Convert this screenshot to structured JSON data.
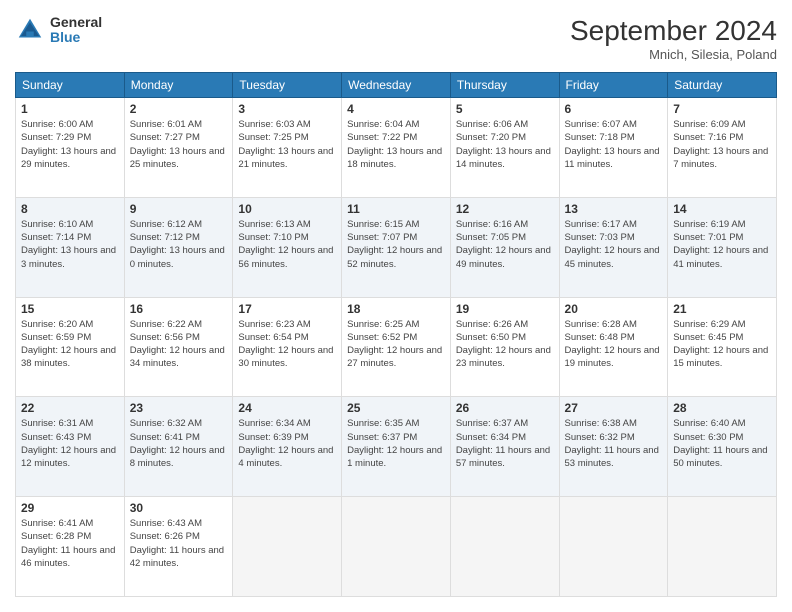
{
  "header": {
    "logo_general": "General",
    "logo_blue": "Blue",
    "month_title": "September 2024",
    "subtitle": "Mnich, Silesia, Poland"
  },
  "days_of_week": [
    "Sunday",
    "Monday",
    "Tuesday",
    "Wednesday",
    "Thursday",
    "Friday",
    "Saturday"
  ],
  "weeks": [
    {
      "days": [
        {
          "num": "1",
          "sunrise": "6:00 AM",
          "sunset": "7:29 PM",
          "daylight": "13 hours and 29 minutes."
        },
        {
          "num": "2",
          "sunrise": "6:01 AM",
          "sunset": "7:27 PM",
          "daylight": "13 hours and 25 minutes."
        },
        {
          "num": "3",
          "sunrise": "6:03 AM",
          "sunset": "7:25 PM",
          "daylight": "13 hours and 21 minutes."
        },
        {
          "num": "4",
          "sunrise": "6:04 AM",
          "sunset": "7:22 PM",
          "daylight": "13 hours and 18 minutes."
        },
        {
          "num": "5",
          "sunrise": "6:06 AM",
          "sunset": "7:20 PM",
          "daylight": "13 hours and 14 minutes."
        },
        {
          "num": "6",
          "sunrise": "6:07 AM",
          "sunset": "7:18 PM",
          "daylight": "13 hours and 11 minutes."
        },
        {
          "num": "7",
          "sunrise": "6:09 AM",
          "sunset": "7:16 PM",
          "daylight": "13 hours and 7 minutes."
        }
      ]
    },
    {
      "days": [
        {
          "num": "8",
          "sunrise": "6:10 AM",
          "sunset": "7:14 PM",
          "daylight": "13 hours and 3 minutes."
        },
        {
          "num": "9",
          "sunrise": "6:12 AM",
          "sunset": "7:12 PM",
          "daylight": "13 hours and 0 minutes."
        },
        {
          "num": "10",
          "sunrise": "6:13 AM",
          "sunset": "7:10 PM",
          "daylight": "12 hours and 56 minutes."
        },
        {
          "num": "11",
          "sunrise": "6:15 AM",
          "sunset": "7:07 PM",
          "daylight": "12 hours and 52 minutes."
        },
        {
          "num": "12",
          "sunrise": "6:16 AM",
          "sunset": "7:05 PM",
          "daylight": "12 hours and 49 minutes."
        },
        {
          "num": "13",
          "sunrise": "6:17 AM",
          "sunset": "7:03 PM",
          "daylight": "12 hours and 45 minutes."
        },
        {
          "num": "14",
          "sunrise": "6:19 AM",
          "sunset": "7:01 PM",
          "daylight": "12 hours and 41 minutes."
        }
      ]
    },
    {
      "days": [
        {
          "num": "15",
          "sunrise": "6:20 AM",
          "sunset": "6:59 PM",
          "daylight": "12 hours and 38 minutes."
        },
        {
          "num": "16",
          "sunrise": "6:22 AM",
          "sunset": "6:56 PM",
          "daylight": "12 hours and 34 minutes."
        },
        {
          "num": "17",
          "sunrise": "6:23 AM",
          "sunset": "6:54 PM",
          "daylight": "12 hours and 30 minutes."
        },
        {
          "num": "18",
          "sunrise": "6:25 AM",
          "sunset": "6:52 PM",
          "daylight": "12 hours and 27 minutes."
        },
        {
          "num": "19",
          "sunrise": "6:26 AM",
          "sunset": "6:50 PM",
          "daylight": "12 hours and 23 minutes."
        },
        {
          "num": "20",
          "sunrise": "6:28 AM",
          "sunset": "6:48 PM",
          "daylight": "12 hours and 19 minutes."
        },
        {
          "num": "21",
          "sunrise": "6:29 AM",
          "sunset": "6:45 PM",
          "daylight": "12 hours and 15 minutes."
        }
      ]
    },
    {
      "days": [
        {
          "num": "22",
          "sunrise": "6:31 AM",
          "sunset": "6:43 PM",
          "daylight": "12 hours and 12 minutes."
        },
        {
          "num": "23",
          "sunrise": "6:32 AM",
          "sunset": "6:41 PM",
          "daylight": "12 hours and 8 minutes."
        },
        {
          "num": "24",
          "sunrise": "6:34 AM",
          "sunset": "6:39 PM",
          "daylight": "12 hours and 4 minutes."
        },
        {
          "num": "25",
          "sunrise": "6:35 AM",
          "sunset": "6:37 PM",
          "daylight": "12 hours and 1 minute."
        },
        {
          "num": "26",
          "sunrise": "6:37 AM",
          "sunset": "6:34 PM",
          "daylight": "11 hours and 57 minutes."
        },
        {
          "num": "27",
          "sunrise": "6:38 AM",
          "sunset": "6:32 PM",
          "daylight": "11 hours and 53 minutes."
        },
        {
          "num": "28",
          "sunrise": "6:40 AM",
          "sunset": "6:30 PM",
          "daylight": "11 hours and 50 minutes."
        }
      ]
    },
    {
      "days": [
        {
          "num": "29",
          "sunrise": "6:41 AM",
          "sunset": "6:28 PM",
          "daylight": "11 hours and 46 minutes."
        },
        {
          "num": "30",
          "sunrise": "6:43 AM",
          "sunset": "6:26 PM",
          "daylight": "11 hours and 42 minutes."
        },
        null,
        null,
        null,
        null,
        null
      ]
    }
  ]
}
